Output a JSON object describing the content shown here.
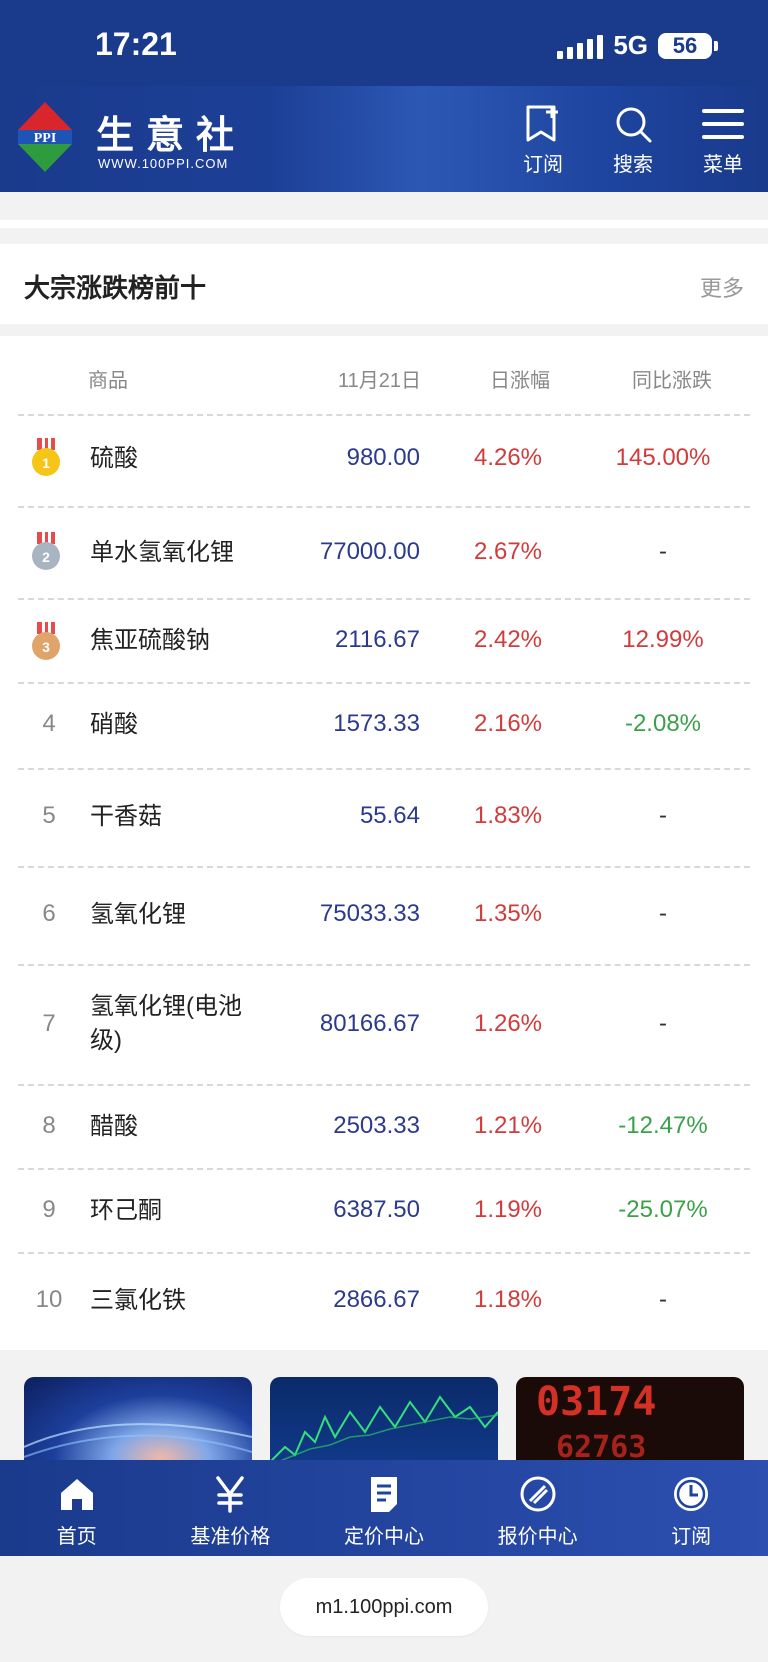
{
  "status_bar": {
    "time": "17:21",
    "network": "5G",
    "battery": "56"
  },
  "header": {
    "logo_text": "生意社",
    "logo_url": "WWW.100PPI.COM",
    "logo_mark": "PPI",
    "buttons": [
      {
        "label": "订阅",
        "icon": "bookmark-plus-icon"
      },
      {
        "label": "搜索",
        "icon": "search-icon"
      },
      {
        "label": "菜单",
        "icon": "menu-icon"
      }
    ]
  },
  "section": {
    "title": "大宗涨跌榜前十",
    "more": "更多"
  },
  "table": {
    "headers": {
      "product": "商品",
      "date": "11月21日",
      "daily": "日涨幅",
      "yoy": "同比涨跌"
    },
    "rows": [
      {
        "rank": "1",
        "name": "硫酸",
        "price": "980.00",
        "daily": "4.26%",
        "yoy": "145.00%"
      },
      {
        "rank": "2",
        "name": "单水氢氧化锂",
        "price": "77000.00",
        "daily": "2.67%",
        "yoy": "-"
      },
      {
        "rank": "3",
        "name": "焦亚硫酸钠",
        "price": "2116.67",
        "daily": "2.42%",
        "yoy": "12.99%"
      },
      {
        "rank": "4",
        "name": "硝酸",
        "price": "1573.33",
        "daily": "2.16%",
        "yoy": "-2.08%"
      },
      {
        "rank": "5",
        "name": "干香菇",
        "price": "55.64",
        "daily": "1.83%",
        "yoy": "-"
      },
      {
        "rank": "6",
        "name": "氢氧化锂",
        "price": "75033.33",
        "daily": "1.35%",
        "yoy": "-"
      },
      {
        "rank": "7",
        "name": "氢氧化锂(电池级)",
        "price": "80166.67",
        "daily": "1.26%",
        "yoy": "-"
      },
      {
        "rank": "8",
        "name": "醋酸",
        "price": "2503.33",
        "daily": "1.21%",
        "yoy": "-12.47%"
      },
      {
        "rank": "9",
        "name": "环己酮",
        "price": "6387.50",
        "daily": "1.19%",
        "yoy": "-25.07%"
      },
      {
        "rank": "10",
        "name": "三氯化铁",
        "price": "2866.67",
        "daily": "1.18%",
        "yoy": "-"
      }
    ]
  },
  "colors": {
    "brand_blue": "#1a3a8c",
    "up_red": "#d23b3b",
    "down_green": "#3ca04a",
    "price_blue": "#2b3a8c"
  },
  "bottom_nav": [
    {
      "label": "首页",
      "icon": "home-icon"
    },
    {
      "label": "基准价格",
      "icon": "yen-icon"
    },
    {
      "label": "定价中心",
      "icon": "document-icon"
    },
    {
      "label": "报价中心",
      "icon": "quote-icon"
    },
    {
      "label": "订阅",
      "icon": "clock-icon"
    }
  ],
  "url_bar": {
    "url": "m1.100ppi.com"
  }
}
